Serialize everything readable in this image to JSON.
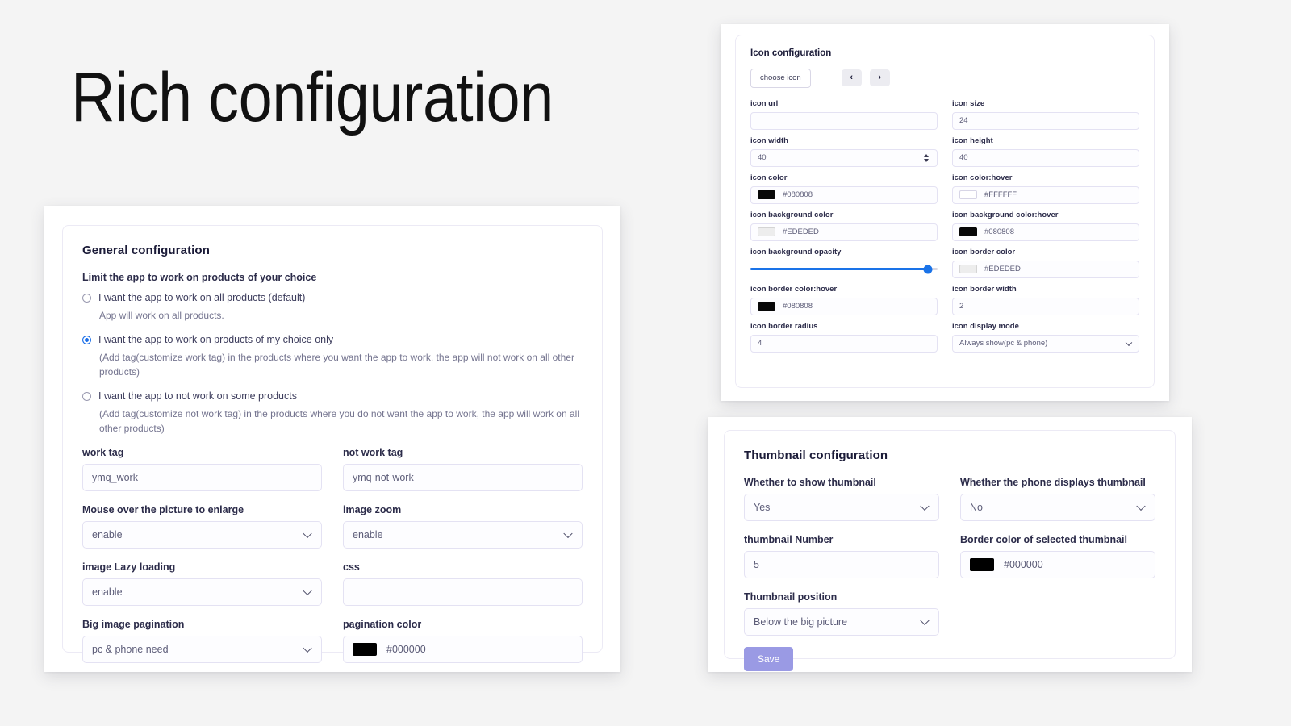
{
  "hero": {
    "title": "Rich configuration"
  },
  "general": {
    "title": "General configuration",
    "limit_label": "Limit the app to work on products of your choice",
    "radios": [
      {
        "label": "I want the app to work on all products (default)",
        "help": "App will work on all products.",
        "checked": false
      },
      {
        "label": "I want the app to work on products of my choice only",
        "help": "(Add tag(customize work tag) in the products where you want the app to work, the app will not work on all other products)",
        "checked": true
      },
      {
        "label": "I want the app to not work on some products",
        "help": "(Add tag(customize not work tag) in the products where you do not want the app to work, the app will work on all other products)",
        "checked": false
      }
    ],
    "fields": {
      "work_tag": {
        "label": "work tag",
        "value": "ymq_work"
      },
      "not_work_tag": {
        "label": "not work tag",
        "value": "ymq-not-work"
      },
      "mouse_over": {
        "label": "Mouse over the picture to enlarge",
        "value": "enable"
      },
      "image_zoom": {
        "label": "image zoom",
        "value": "enable"
      },
      "lazy_loading": {
        "label": "image Lazy loading",
        "value": "enable"
      },
      "css": {
        "label": "css",
        "value": ""
      },
      "big_image_pagination": {
        "label": "Big image pagination",
        "value": "pc & phone need"
      },
      "pagination_color": {
        "label": "pagination color",
        "value": "#000000",
        "swatch": "#000000"
      }
    }
  },
  "icon": {
    "title": "Icon configuration",
    "choose_label": "choose icon",
    "prev_label": "‹",
    "next_label": "›",
    "fields": {
      "icon_url": {
        "label": "icon url",
        "value": ""
      },
      "icon_size": {
        "label": "icon size",
        "value": "24"
      },
      "icon_width": {
        "label": "icon width",
        "value": "40"
      },
      "icon_height": {
        "label": "icon height",
        "value": "40"
      },
      "icon_color": {
        "label": "icon color",
        "value": "#080808",
        "swatch": "#080808"
      },
      "icon_color_hover": {
        "label": "icon color:hover",
        "value": "#FFFFFF",
        "swatch": "#FFFFFF"
      },
      "icon_bg_color": {
        "label": "icon background color",
        "value": "#EDEDED",
        "swatch": "#EDEDED"
      },
      "icon_bg_color_hover": {
        "label": "icon background color:hover",
        "value": "#080808",
        "swatch": "#080808"
      },
      "icon_bg_opacity": {
        "label": "icon background opacity",
        "value": 95
      },
      "icon_border_color": {
        "label": "icon border color",
        "value": "#EDEDED",
        "swatch": "#EDEDED"
      },
      "icon_border_color_hover": {
        "label": "icon border color:hover",
        "value": "#080808",
        "swatch": "#080808"
      },
      "icon_border_width": {
        "label": "icon border width",
        "value": "2"
      },
      "icon_border_radius": {
        "label": "icon border radius",
        "value": "4"
      },
      "icon_display_mode": {
        "label": "icon display mode",
        "value": "Always show(pc & phone)"
      }
    }
  },
  "thumbnail": {
    "title": "Thumbnail configuration",
    "fields": {
      "show_thumbnail": {
        "label": "Whether to show thumbnail",
        "value": "Yes"
      },
      "phone_thumbnail": {
        "label": "Whether the phone displays thumbnail",
        "value": "No"
      },
      "thumbnail_number": {
        "label": "thumbnail Number",
        "value": "5"
      },
      "selected_border_color": {
        "label": "Border color of selected thumbnail",
        "value": "#000000",
        "swatch": "#000000"
      },
      "thumbnail_position": {
        "label": "Thumbnail position",
        "value": "Below the big picture"
      }
    },
    "save_label": "Save"
  },
  "colors": {
    "accent_blue": "#1a73e8",
    "save_purple": "#9a9ae4",
    "page_bg": "#f4f4f4"
  }
}
